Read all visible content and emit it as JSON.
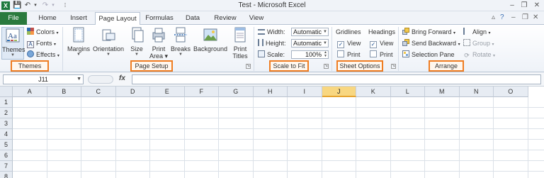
{
  "window": {
    "title": "Test  -  Microsoft Excel",
    "app_icon": "X",
    "minimize_glyph": "–",
    "restore_glyph": "❐",
    "close_glyph": "✕"
  },
  "tabs": [
    "File",
    "Home",
    "Insert",
    "Page Layout",
    "Formulas",
    "Data",
    "Review",
    "View"
  ],
  "active_tab": "Page Layout",
  "ribbon": {
    "themes": {
      "group_label": "Themes",
      "themes_button": "Themes",
      "colors": "Colors",
      "fonts": "Fonts",
      "effects": "Effects"
    },
    "page_setup": {
      "group_label": "Page Setup",
      "margins": "Margins",
      "orientation": "Orientation",
      "size": "Size",
      "print_area_1": "Print",
      "print_area_2": "Area",
      "breaks": "Breaks",
      "background": "Background",
      "print_titles_1": "Print",
      "print_titles_2": "Titles"
    },
    "scale_to_fit": {
      "group_label": "Scale to Fit",
      "width_label": "Width:",
      "width_value": "Automatic",
      "height_label": "Height:",
      "height_value": "Automatic",
      "scale_label": "Scale:",
      "scale_value": "100%"
    },
    "sheet_options": {
      "group_label": "Sheet Options",
      "gridlines": "Gridlines",
      "headings": "Headings",
      "view": "View",
      "print": "Print",
      "gridlines_view_checked": true,
      "gridlines_print_checked": false,
      "headings_view_checked": true,
      "headings_print_checked": false
    },
    "arrange": {
      "group_label": "Arrange",
      "bring_forward": "Bring Forward",
      "send_backward": "Send Backward",
      "selection_pane": "Selection Pane",
      "align": "Align",
      "group": "Group",
      "rotate": "Rotate"
    }
  },
  "formula_bar": {
    "name_box": "J11",
    "fx": "fx",
    "formula": ""
  },
  "grid": {
    "columns": [
      "A",
      "B",
      "C",
      "D",
      "E",
      "F",
      "G",
      "H",
      "I",
      "J",
      "K",
      "L",
      "M",
      "N",
      "O"
    ],
    "rows": [
      "1",
      "2",
      "3",
      "4",
      "5",
      "6",
      "7",
      "8"
    ],
    "selected_column": "J"
  },
  "colors": {
    "file_tab": "#2a7a3d",
    "highlight_box": "#ef7d22",
    "selected_header": "#f8d781"
  }
}
